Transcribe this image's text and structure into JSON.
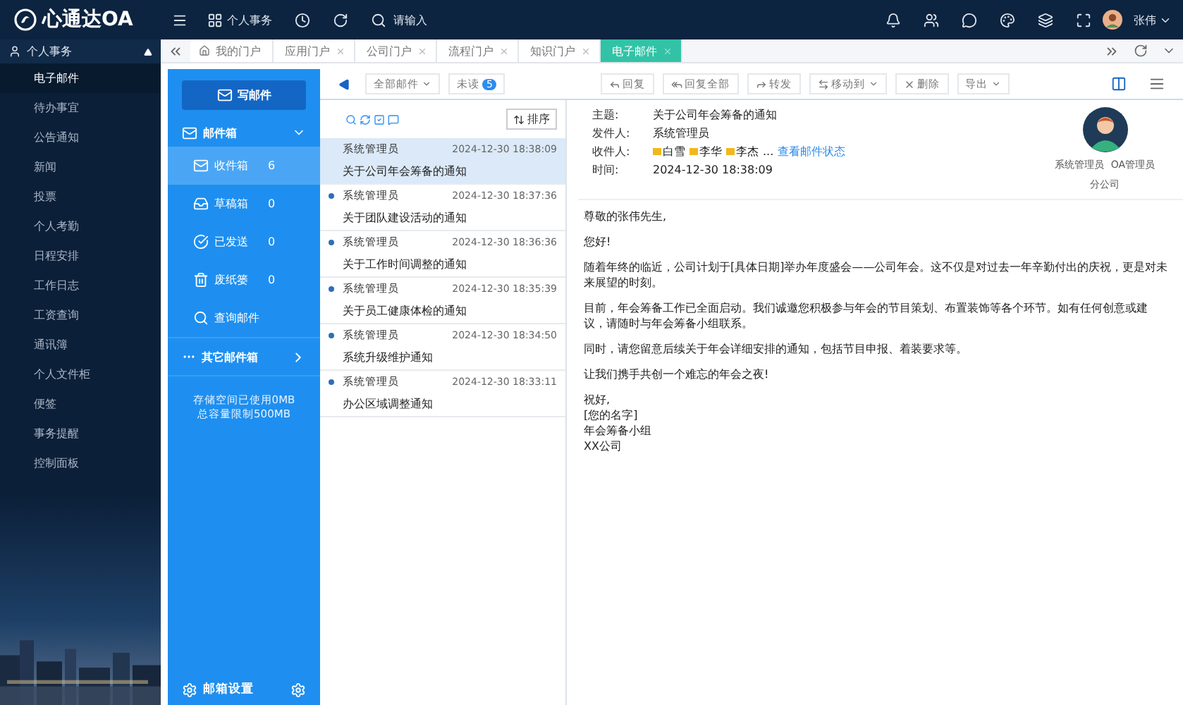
{
  "app": {
    "logo": "心通达OA"
  },
  "topbar": {
    "menu": "个人事务",
    "search": {
      "placeholder": "请输入"
    },
    "user": "张伟"
  },
  "sidebar": {
    "section": "个人事务",
    "expanded": true,
    "items": [
      {
        "label": "电子邮件",
        "selected": true
      },
      {
        "label": "待办事宜",
        "selected": false
      },
      {
        "label": "公告通知",
        "selected": false
      },
      {
        "label": "新闻",
        "selected": false
      },
      {
        "label": "投票",
        "selected": false
      },
      {
        "label": "个人考勤",
        "selected": false
      },
      {
        "label": "日程安排",
        "selected": false
      },
      {
        "label": "工作日志",
        "selected": false
      },
      {
        "label": "工资查询",
        "selected": false
      },
      {
        "label": "通讯簿",
        "selected": false
      },
      {
        "label": "个人文件柜",
        "selected": false
      },
      {
        "label": "便签",
        "selected": false
      },
      {
        "label": "事务提醒",
        "selected": false
      },
      {
        "label": "控制面板",
        "selected": false
      }
    ]
  },
  "tabs": [
    {
      "label": "我的门户",
      "selected": false,
      "closable": false
    },
    {
      "label": "应用门户",
      "selected": false,
      "closable": true
    },
    {
      "label": "公司门户",
      "selected": false,
      "closable": true
    },
    {
      "label": "流程门户",
      "selected": false,
      "closable": true
    },
    {
      "label": "知识门户",
      "selected": false,
      "closable": true
    },
    {
      "label": "电子邮件",
      "selected": true,
      "closable": true
    }
  ],
  "folders": {
    "compose": "写邮件",
    "mailbox": "邮件箱",
    "items": [
      {
        "kind": "inbox",
        "label": "收件箱",
        "count": "6",
        "selected": true
      },
      {
        "kind": "drafts",
        "label": "草稿箱",
        "count": "0",
        "selected": false
      },
      {
        "kind": "sent",
        "label": "已发送",
        "count": "0",
        "selected": false
      },
      {
        "kind": "trash",
        "label": "废纸篓",
        "count": "0",
        "selected": false
      },
      {
        "kind": "search",
        "label": "查询邮件",
        "selected": false
      }
    ],
    "other": "其它邮件箱",
    "storage": [
      "存储空间已使用0MB",
      "总容量限制500MB"
    ],
    "settings": "邮箱设置"
  },
  "toolbar": {
    "filter": "全部邮件",
    "unread": "未读",
    "unread_count": "5",
    "actions": [
      "回复",
      "回复全部",
      "转发",
      "移动到",
      "删除",
      "导出"
    ]
  },
  "list": {
    "sort": "排序",
    "rows": [
      {
        "sender": "系统管理员",
        "time": "2024-12-30 18:38:09",
        "subject": "关于公司年会筹备的通知",
        "selected": true,
        "unread": false
      },
      {
        "sender": "系统管理员",
        "time": "2024-12-30 18:37:36",
        "subject": "关于团队建设活动的通知",
        "selected": false,
        "unread": true
      },
      {
        "sender": "系统管理员",
        "time": "2024-12-30 18:36:36",
        "subject": "关于工作时间调整的通知",
        "selected": false,
        "unread": true
      },
      {
        "sender": "系统管理员",
        "time": "2024-12-30 18:35:39",
        "subject": "关于员工健康体检的通知",
        "selected": false,
        "unread": true
      },
      {
        "sender": "系统管理员",
        "time": "2024-12-30 18:34:50",
        "subject": "系统升级维护通知",
        "selected": false,
        "unread": true
      },
      {
        "sender": "系统管理员",
        "time": "2024-12-30 18:33:11",
        "subject": "办公区域调整通知",
        "selected": false,
        "unread": true
      }
    ]
  },
  "message": {
    "fields": [
      {
        "label": "主题:",
        "value": "关于公司年会筹备的通知"
      },
      {
        "label": "发件人:",
        "value": "系统管理员"
      },
      {
        "label": "收件人:",
        "recipients": [
          "白雪",
          "李华",
          "李杰"
        ],
        "more": "...",
        "link": "查看邮件状态"
      },
      {
        "label": "时间:",
        "value": "2024-12-30 18:38:09"
      }
    ],
    "profile": {
      "name": "系统管理员",
      "role": "OA管理员",
      "dept": "分公司"
    },
    "body": [
      "尊敬的张伟先生,",
      "您好!",
      "随着年终的临近，公司计划于[具体日期]举办年度盛会——公司年会。这不仅是对过去一年辛勤付出的庆祝，更是对未来展望的时刻。",
      "目前，年会筹备工作已全面启动。我们诚邀您积极参与年会的节目策划、布置装饰等各个环节。如有任何创意或建议，请随时与年会筹备小组联系。",
      "同时，请您留意后续关于年会详细安排的通知，包括节目申报、着装要求等。",
      "让我们携手共创一个难忘的年会之夜!"
    ],
    "signature": [
      "祝好,",
      "[您的名字]",
      "年会筹备小组",
      "XX公司"
    ]
  }
}
